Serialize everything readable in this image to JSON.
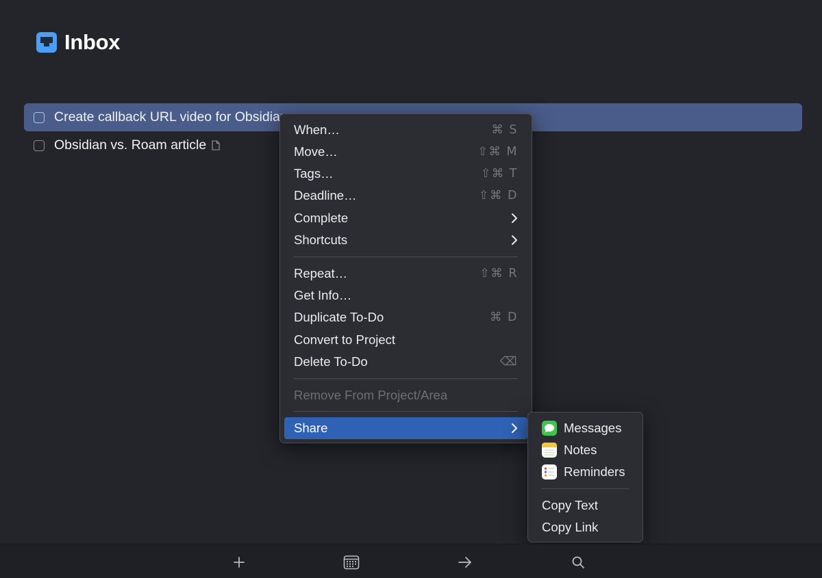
{
  "header": {
    "title": "Inbox"
  },
  "tasks": [
    {
      "title": "Create callback URL video for Obsidian",
      "selected": true
    },
    {
      "title": "Obsidian vs. Roam article",
      "has_note": true
    }
  ],
  "context_menu": {
    "items": [
      {
        "label": "When…",
        "shortcut": "⌘ S"
      },
      {
        "label": "Move…",
        "shortcut": "⇧⌘ M"
      },
      {
        "label": "Tags…",
        "shortcut": "⇧⌘ T"
      },
      {
        "label": "Deadline…",
        "shortcut": "⇧⌘ D"
      },
      {
        "label": "Complete",
        "submenu": true
      },
      {
        "label": "Shortcuts",
        "submenu": true
      },
      {
        "label": "Repeat…",
        "shortcut": "⇧⌘ R"
      },
      {
        "label": "Get Info…"
      },
      {
        "label": "Duplicate To-Do",
        "shortcut": "⌘ D"
      },
      {
        "label": "Convert to Project"
      },
      {
        "label": "Delete To-Do",
        "shortcut": "⌫"
      },
      {
        "label": "Remove From Project/Area",
        "disabled": true
      },
      {
        "label": "Share",
        "submenu": true,
        "active": true
      }
    ]
  },
  "share_submenu": {
    "items": [
      {
        "label": "Messages",
        "icon": "messages-app-icon"
      },
      {
        "label": "Notes",
        "icon": "notes-app-icon"
      },
      {
        "label": "Reminders",
        "icon": "reminders-app-icon"
      },
      {
        "label": "Copy Text"
      },
      {
        "label": "Copy Link"
      }
    ]
  },
  "toolbar": {
    "buttons": [
      "plus-icon",
      "calendar-icon",
      "arrow-right-icon",
      "search-icon"
    ]
  },
  "colors": {
    "background": "#23252b",
    "selection": "#4a5c8a",
    "accent": "#2f62b4",
    "inbox_icon": "#4a9ff5"
  }
}
